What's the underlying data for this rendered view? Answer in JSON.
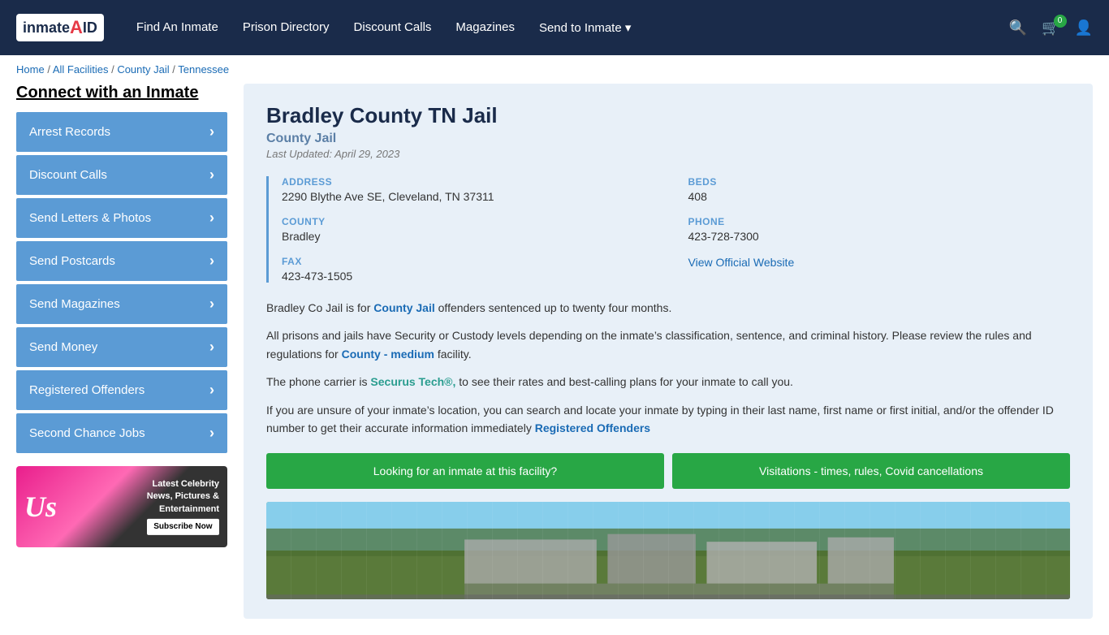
{
  "nav": {
    "logo_text": "inmateAID",
    "links": [
      {
        "label": "Find An Inmate",
        "key": "find-inmate"
      },
      {
        "label": "Prison Directory",
        "key": "prison-directory"
      },
      {
        "label": "Discount Calls",
        "key": "discount-calls"
      },
      {
        "label": "Magazines",
        "key": "magazines"
      },
      {
        "label": "Send to Inmate ▾",
        "key": "send-to-inmate"
      }
    ],
    "cart_count": "0"
  },
  "breadcrumb": {
    "items": [
      "Home",
      "All Facilities",
      "County Jail",
      "Tennessee"
    ]
  },
  "sidebar": {
    "title": "Connect with an Inmate",
    "items": [
      {
        "label": "Arrest Records",
        "key": "arrest-records"
      },
      {
        "label": "Discount Calls",
        "key": "discount-calls"
      },
      {
        "label": "Send Letters & Photos",
        "key": "send-letters"
      },
      {
        "label": "Send Postcards",
        "key": "send-postcards"
      },
      {
        "label": "Send Magazines",
        "key": "send-magazines"
      },
      {
        "label": "Send Money",
        "key": "send-money"
      },
      {
        "label": "Registered Offenders",
        "key": "registered-offenders"
      },
      {
        "label": "Second Chance Jobs",
        "key": "second-chance-jobs"
      }
    ]
  },
  "ad": {
    "logo": "Us",
    "line1": "Latest Celebrity",
    "line2": "News, Pictures &",
    "line3": "Entertainment",
    "btn": "Subscribe Now"
  },
  "facility": {
    "title": "Bradley County TN Jail",
    "type": "County Jail",
    "last_updated": "Last Updated: April 29, 2023",
    "address_label": "ADDRESS",
    "address_value": "2290 Blythe Ave SE, Cleveland, TN 37311",
    "beds_label": "BEDS",
    "beds_value": "408",
    "county_label": "COUNTY",
    "county_value": "Bradley",
    "phone_label": "PHONE",
    "phone_value": "423-728-7300",
    "fax_label": "FAX",
    "fax_value": "423-473-1505",
    "website_link": "View Official Website",
    "desc1": "Bradley Co Jail is for ",
    "desc1_link": "County Jail",
    "desc1_end": " offenders sentenced up to twenty four months.",
    "desc2": "All prisons and jails have Security or Custody levels depending on the inmate’s classification, sentence, and criminal history. Please review the rules and regulations for ",
    "desc2_link": "County - medium",
    "desc2_end": " facility.",
    "desc3": "The phone carrier is ",
    "desc3_link": "Securus Tech®,",
    "desc3_end": " to see their rates and best-calling plans for your inmate to call you.",
    "desc4": "If you are unsure of your inmate’s location, you can search and locate your inmate by typing in their last name, first name or first initial, and/or the offender ID number to get their accurate information immediately ",
    "desc4_link": "Registered Offenders",
    "btn1": "Looking for an inmate at this facility?",
    "btn2": "Visitations - times, rules, Covid cancellations"
  }
}
